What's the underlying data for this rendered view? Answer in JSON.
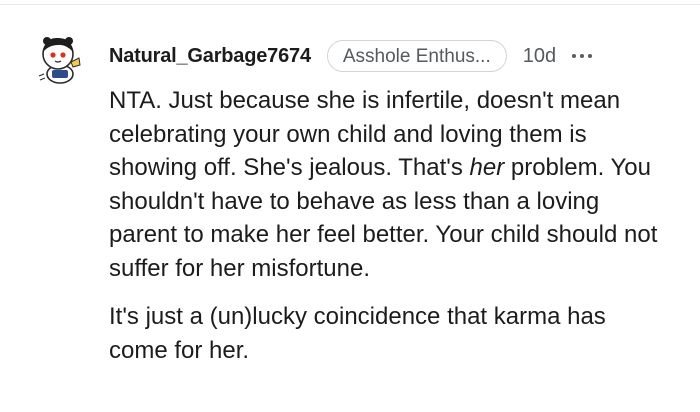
{
  "comment": {
    "username": "Natural_Garbage7674",
    "flair": "Asshole Enthus...",
    "age": "10d",
    "paragraph1": {
      "before_em": "NTA. Just because she is infertile, doesn't mean celebrating your own child and loving them is showing off. She's jealous. That's ",
      "em": "her",
      "after_em": " problem. You shouldn't have to behave as less than a loving parent to make her feel better. Your child should not suffer for her misfortune."
    },
    "paragraph2": "It's just a (un)lucky coincidence that karma has come for her."
  },
  "icons": {
    "avatar": "snoo-avatar-icon",
    "more": "more-options-icon"
  }
}
